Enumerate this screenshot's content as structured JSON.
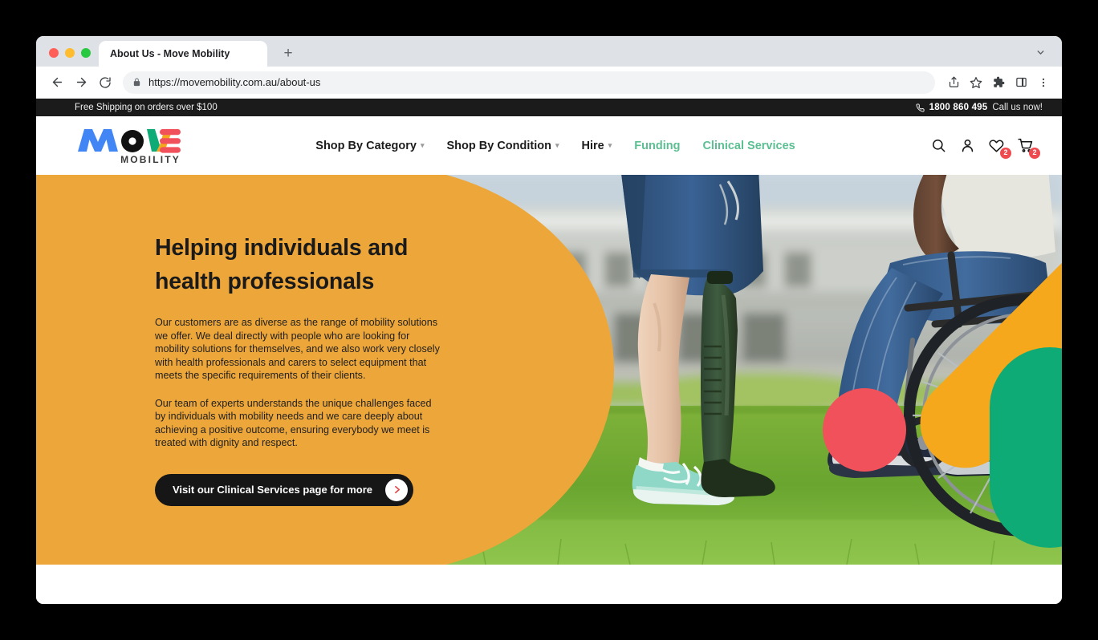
{
  "browser": {
    "tab_title": "About Us - Move Mobility",
    "new_tab_label": "+",
    "url": "https://movemobility.com.au/about-us",
    "icons": {
      "back": "back-arrow-icon",
      "forward": "forward-arrow-icon",
      "reload": "reload-icon",
      "lock": "lock-icon",
      "share": "share-icon",
      "bookmark": "star-icon",
      "extensions": "puzzle-icon",
      "sidepanel": "side-panel-icon",
      "menu": "three-dot-menu-icon",
      "tab_search": "chevron-down-icon"
    }
  },
  "announcement": {
    "shipping_text": "Free Shipping on orders over $100",
    "phone_icon": "phone-icon",
    "phone": "1800 860 495",
    "call_text": "Call us now!"
  },
  "site_header": {
    "logo": {
      "word": "MOVE",
      "subtitle": "MOBILITY",
      "colors": {
        "m": "#4285f4",
        "o": "#111111",
        "v_left": "#0eab76",
        "v_right": "#f5a81c",
        "e": "#f0515a",
        "subtitle": "#3a3a3a"
      }
    },
    "nav": [
      {
        "label": "Shop By Category",
        "has_dropdown": true,
        "accent": false
      },
      {
        "label": "Shop By Condition",
        "has_dropdown": true,
        "accent": false
      },
      {
        "label": "Hire",
        "has_dropdown": true,
        "accent": false
      },
      {
        "label": "Funding",
        "has_dropdown": false,
        "accent": true
      },
      {
        "label": "Clinical Services",
        "has_dropdown": false,
        "accent": true
      }
    ],
    "icons": [
      {
        "name": "search-icon",
        "badge": ""
      },
      {
        "name": "account-icon",
        "badge": ""
      },
      {
        "name": "wishlist-heart-icon",
        "badge": "2"
      },
      {
        "name": "cart-icon",
        "badge": "2"
      }
    ],
    "accent_color": "#5cbf92"
  },
  "hero": {
    "background_color": "#eda63a",
    "heading": "Helping individuals and health professionals",
    "paragraph_1": "Our customers are as diverse as the range of mobility solutions we offer. We deal directly with people who are looking for mobility solutions for themselves, and we also work very closely with health professionals and carers to select equipment that meets the specific requirements of their clients.",
    "paragraph_2": "Our team of experts understands the unique challenges faced by individuals with mobility needs and we care deeply about achieving a positive outcome, ensuring everybody we meet is treated with dignity and respect.",
    "cta_label": "Visit our Clinical Services page for more",
    "cta_arrow_icon": "chevron-right-icon",
    "photo_description": "Person with a green prosthetic leg standing on grass facing a person seated in a wheelchair",
    "decorative_shapes": [
      {
        "name": "orange-diagonal-bar",
        "color": "#f5a81c"
      },
      {
        "name": "green-rounded-shape",
        "color": "#0eab76"
      },
      {
        "name": "red-circle",
        "color": "#f0515a"
      }
    ]
  }
}
